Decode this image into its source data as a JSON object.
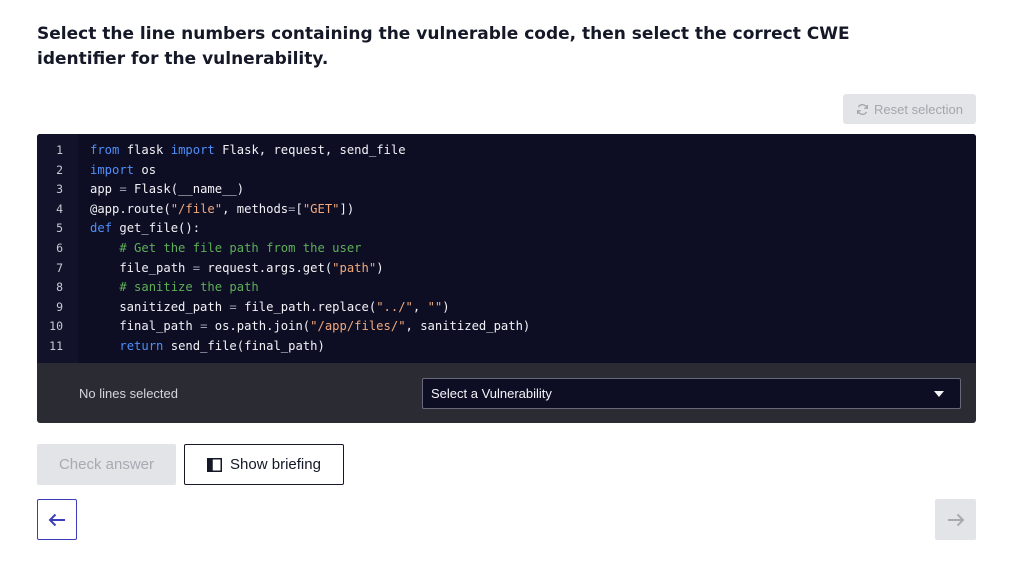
{
  "instructions": "Select the line numbers containing the vulnerable code, then select the correct CWE identifier for the vulnerability.",
  "reset_label": "Reset selection",
  "code_lines": [
    {
      "no": "1",
      "tokens": [
        {
          "t": "from",
          "c": "kw"
        },
        {
          "t": " flask ",
          "c": ""
        },
        {
          "t": "import",
          "c": "kw"
        },
        {
          "t": " Flask, request, send_file",
          "c": ""
        }
      ]
    },
    {
      "no": "2",
      "tokens": [
        {
          "t": "import",
          "c": "kw"
        },
        {
          "t": " os",
          "c": ""
        }
      ]
    },
    {
      "no": "3",
      "tokens": [
        {
          "t": "app ",
          "c": ""
        },
        {
          "t": "=",
          "c": "op"
        },
        {
          "t": " Flask(__name__)",
          "c": ""
        }
      ]
    },
    {
      "no": "4",
      "tokens": [
        {
          "t": "@app.route(",
          "c": ""
        },
        {
          "t": "\"/file\"",
          "c": "str"
        },
        {
          "t": ", methods",
          "c": ""
        },
        {
          "t": "=",
          "c": "op"
        },
        {
          "t": "[",
          "c": ""
        },
        {
          "t": "\"GET\"",
          "c": "str"
        },
        {
          "t": "])",
          "c": ""
        }
      ]
    },
    {
      "no": "5",
      "tokens": [
        {
          "t": "def",
          "c": "kw"
        },
        {
          "t": " get_file():",
          "c": ""
        }
      ]
    },
    {
      "no": "6",
      "tokens": [
        {
          "t": "    ",
          "c": ""
        },
        {
          "t": "# Get the file path from the user",
          "c": "cm"
        }
      ]
    },
    {
      "no": "7",
      "tokens": [
        {
          "t": "    file_path ",
          "c": ""
        },
        {
          "t": "=",
          "c": "op"
        },
        {
          "t": " request.args.get(",
          "c": ""
        },
        {
          "t": "\"path\"",
          "c": "str"
        },
        {
          "t": ")",
          "c": ""
        }
      ]
    },
    {
      "no": "8",
      "tokens": [
        {
          "t": "    ",
          "c": ""
        },
        {
          "t": "# sanitize the path",
          "c": "cm"
        }
      ]
    },
    {
      "no": "9",
      "tokens": [
        {
          "t": "    sanitized_path ",
          "c": ""
        },
        {
          "t": "=",
          "c": "op"
        },
        {
          "t": " file_path.replace(",
          "c": ""
        },
        {
          "t": "\"../\"",
          "c": "str"
        },
        {
          "t": ", ",
          "c": ""
        },
        {
          "t": "\"\"",
          "c": "str"
        },
        {
          "t": ")",
          "c": ""
        }
      ]
    },
    {
      "no": "10",
      "tokens": [
        {
          "t": "    final_path ",
          "c": ""
        },
        {
          "t": "=",
          "c": "op"
        },
        {
          "t": " os.path.join(",
          "c": ""
        },
        {
          "t": "\"/app/files/\"",
          "c": "str"
        },
        {
          "t": ", sanitized_path)",
          "c": ""
        }
      ]
    },
    {
      "no": "11",
      "tokens": [
        {
          "t": "    ",
          "c": ""
        },
        {
          "t": "return",
          "c": "kw"
        },
        {
          "t": " send_file(final_path)",
          "c": ""
        }
      ]
    }
  ],
  "status": "No lines selected",
  "vulnerability_select": {
    "value": "Select a Vulnerability"
  },
  "check_label": "Check answer",
  "briefing_label": "Show briefing",
  "icons": {
    "reset": "refresh-icon",
    "briefing": "book-icon",
    "prev": "arrow-left-icon",
    "next": "arrow-right-icon"
  },
  "colors": {
    "code_bg": "#0d0e24",
    "panel_bg": "#2b2c33",
    "keyword": "#4f8ff7",
    "string": "#f2a97d",
    "comment": "#5fae59",
    "accent": "#3a3fb9"
  }
}
